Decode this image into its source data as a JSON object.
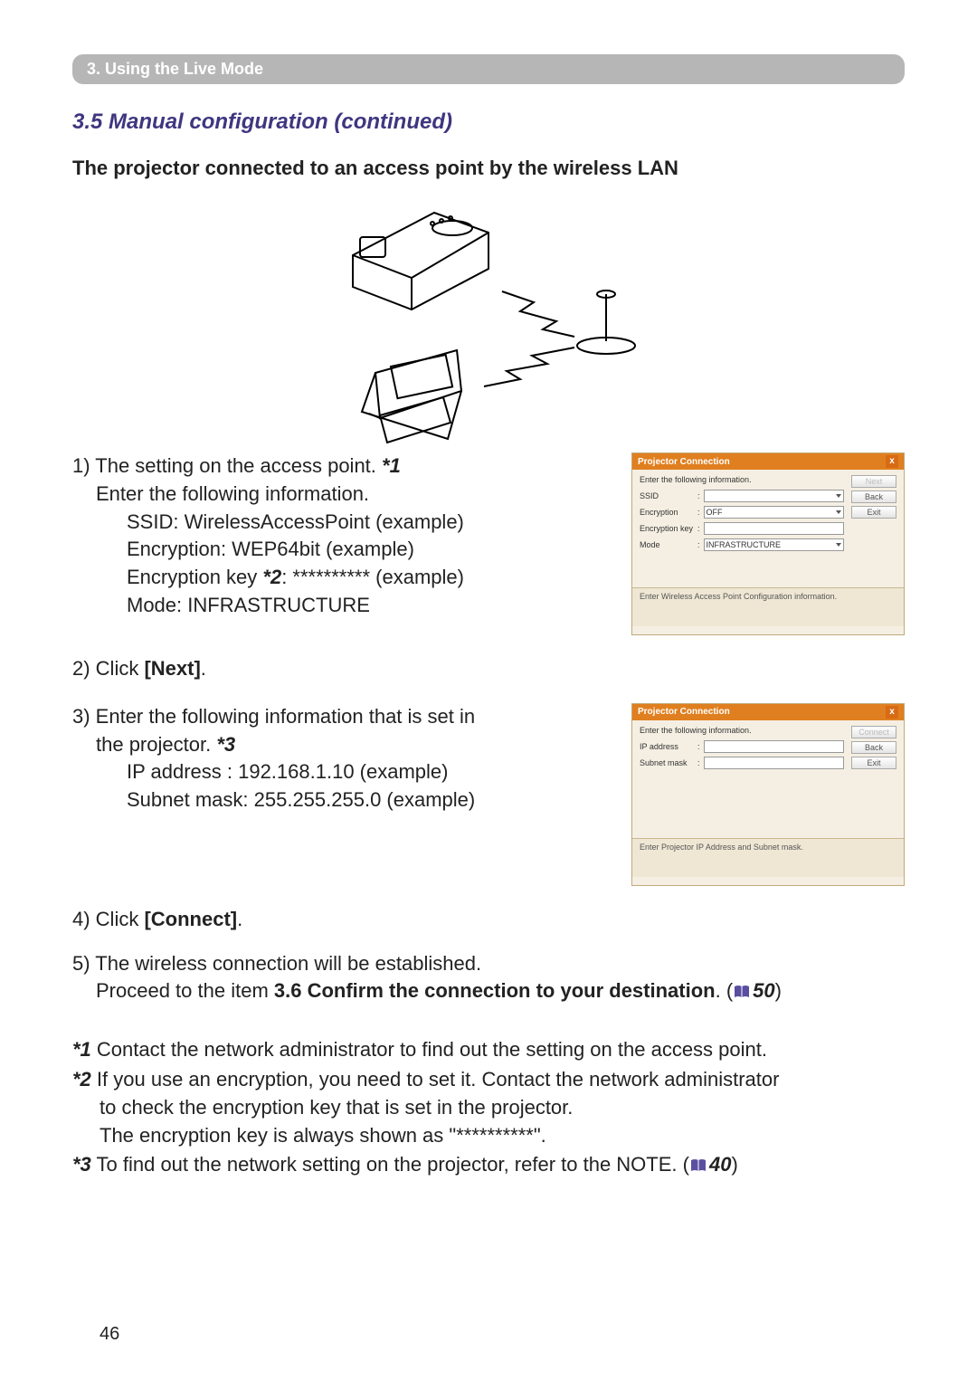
{
  "banner": "3. Using the Live Mode",
  "section_title": "3.5 Manual configuration (continued)",
  "subtitle": "The projector connected to an access point by the wireless LAN",
  "step1": {
    "lead": "1) The setting on the access point. ",
    "ref": "*1",
    "line2": "Enter the following information.",
    "ssid": "SSID: WirelessAccessPoint (example)",
    "enc": "Encryption: WEP64bit (example)",
    "key_lead": "Encryption key ",
    "key_ref": "*2",
    "key_tail": ": ********** (example)",
    "mode": "Mode: INFRASTRUCTURE"
  },
  "step2": {
    "lead": "2) Click ",
    "bold": "[Next]",
    "tail": "."
  },
  "step3": {
    "lead": "3) Enter the following information that is set in",
    "line2_a": "the projector. ",
    "line2_ref": "*3",
    "ip": "IP address : 192.168.1.10 (example)",
    "mask": "Subnet mask: 255.255.255.0 (example)"
  },
  "step4": {
    "lead": "4) Click ",
    "bold": "[Connect]",
    "tail": "."
  },
  "step5": {
    "line1": "5) The wireless connection will be established.",
    "line2_a": "Proceed to the item ",
    "line2_bold": "3.6 Confirm the connection to your destination",
    "line2_b": ". (",
    "pageref": "50",
    "line2_c": ")"
  },
  "fn1": {
    "ref": "*1",
    "text": " Contact the network administrator to find out the setting on the access point."
  },
  "fn2": {
    "ref": "*2",
    "line1": " If you use an encryption, you need to set it. Contact the network administrator",
    "line2": "to check the encryption key that is set in the projector.",
    "line3": "The encryption key is always shown as \"**********\"."
  },
  "fn3": {
    "ref": "*3",
    "text_a": " To find out the network setting on the projector, refer to the NOTE. (",
    "pageref": "40",
    "text_b": ")"
  },
  "ss1": {
    "title": "Projector Connection",
    "instr": "Enter the following information.",
    "labels": {
      "ssid": "SSID",
      "enc": "Encryption",
      "key": "Encryption key",
      "mode": "Mode"
    },
    "enc_value": "OFF",
    "mode_value": "INFRASTRUCTURE",
    "buttons": {
      "next": "Next",
      "back": "Back",
      "exit": "Exit"
    },
    "footer": "Enter Wireless Access Point Configuration information."
  },
  "ss2": {
    "title": "Projector Connection",
    "instr": "Enter the following information.",
    "labels": {
      "ip": "IP address",
      "mask": "Subnet mask"
    },
    "buttons": {
      "connect": "Connect",
      "back": "Back",
      "exit": "Exit"
    },
    "footer": "Enter Projector IP Address and Subnet mask."
  },
  "page_number": "46"
}
